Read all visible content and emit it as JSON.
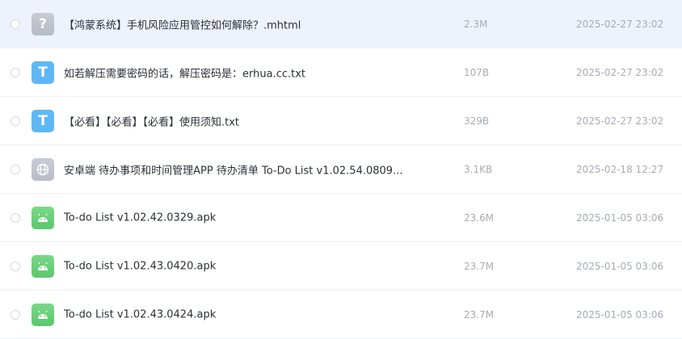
{
  "files": [
    {
      "name": "【鸿蒙系统】手机风险应用管控如何解除？.mhtml",
      "size": "2.3M",
      "date": "2025-02-27 23:02",
      "icon": "?",
      "type": "unknown",
      "selected": true
    },
    {
      "name": "如若解压需要密码的话，解压密码是：erhua.cc.txt",
      "size": "107B",
      "date": "2025-02-27 23:02",
      "icon": "T",
      "type": "text"
    },
    {
      "name": "【必看】【必看】【必看】使用须知.txt",
      "size": "329B",
      "date": "2025-02-27 23:02",
      "icon": "T",
      "type": "text"
    },
    {
      "name": "安卓端 待办事项和时间管理APP 待办清单 To-Do List v1.02.54.0809...",
      "size": "3.1KB",
      "date": "2025-02-18 12:27",
      "icon": "",
      "type": "web"
    },
    {
      "name": "To-do List v1.02.42.0329.apk",
      "size": "23.6M",
      "date": "2025-01-05 03:06",
      "icon": "",
      "type": "apk"
    },
    {
      "name": "To-do List v1.02.43.0420.apk",
      "size": "23.7M",
      "date": "2025-01-05 03:06",
      "icon": "",
      "type": "apk"
    },
    {
      "name": "To-do List v1.02.43.0424.apk",
      "size": "23.7M",
      "date": "2025-01-05 03:06",
      "icon": "",
      "type": "apk"
    }
  ],
  "colors": {
    "selected_row_bg": "#eef2fd",
    "text_icon": "#5fb8f3",
    "apk_icon": "#5cc66d",
    "muted_text": "#a7abb4"
  }
}
